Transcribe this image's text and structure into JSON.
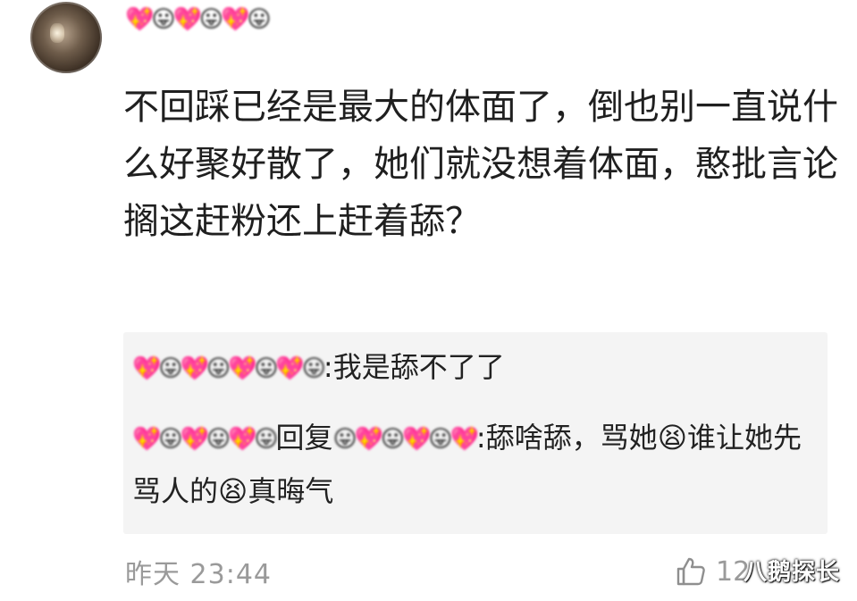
{
  "user": {
    "avatar_icon": "user-avatar-photo",
    "name_masked": "💖😛💖😛💖😛"
  },
  "comment": {
    "text": "不回踩已经是最大的体面了，倒也别一直说什么好聚好散了，她们就没想着体面，憨批言论搁这赶粉还上赶着舔？"
  },
  "quoted_replies": {
    "reply1": {
      "author_masked": "💖😛💖😛💖😛💖😛",
      "text": ":我是舔不了了"
    },
    "reply2": {
      "author_masked": "💖😛💖😛💖😛",
      "reply_word": "回复",
      "target_masked": "😛💖😛💖😛💖",
      "text_part1": ":舔啥舔，骂她",
      "emoji": "😫",
      "text_part2": "谁让她先骂人的",
      "text_part3": "真晦气"
    }
  },
  "footer": {
    "time": "昨天 23:44",
    "like_icon": "thumbs-up-icon",
    "like_count": "12"
  },
  "watermark": {
    "text": "八鹅探长"
  }
}
